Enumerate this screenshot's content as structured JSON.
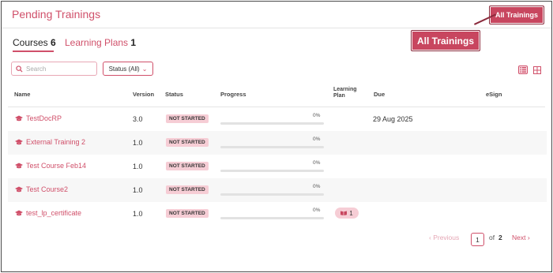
{
  "header": {
    "title": "Pending Trainings",
    "all_trainings_button": "All Trainings",
    "callout_label": "All Trainings"
  },
  "tabs": [
    {
      "label": "Courses",
      "count": "6",
      "active": true
    },
    {
      "label": "Learning Plans",
      "count": "1",
      "active": false
    }
  ],
  "filters": {
    "search_placeholder": "Search",
    "status_label": "Status (All)"
  },
  "columns": {
    "name": "Name",
    "version": "Version",
    "status": "Status",
    "progress": "Progress",
    "learning_plan_line1": "Learning",
    "learning_plan_line2": "Plan",
    "due": "Due",
    "esign": "eSign"
  },
  "rows": [
    {
      "name": "TestDocRP",
      "version": "3.0",
      "status": "NOT STARTED",
      "progress": 0,
      "progress_label": "0%",
      "due": "29 Aug 2025",
      "learning_plan": ""
    },
    {
      "name": "External Training 2",
      "version": "1.0",
      "status": "NOT STARTED",
      "progress": 0,
      "progress_label": "0%",
      "due": "",
      "learning_plan": ""
    },
    {
      "name": "Test Course Feb14",
      "version": "1.0",
      "status": "NOT STARTED",
      "progress": 0,
      "progress_label": "0%",
      "due": "",
      "learning_plan": ""
    },
    {
      "name": "Test Course2",
      "version": "1.0",
      "status": "NOT STARTED",
      "progress": 0,
      "progress_label": "0%",
      "due": "",
      "learning_plan": ""
    },
    {
      "name": "test_lp_certificate",
      "version": "1.0",
      "status": "NOT STARTED",
      "progress": 0,
      "progress_label": "0%",
      "due": "",
      "learning_plan": "1"
    }
  ],
  "pagination": {
    "previous": "‹ Previous",
    "current": "1",
    "of": "of",
    "total": "2",
    "next": "Next ›"
  },
  "colors": {
    "accent": "#d0506a",
    "badge_bg": "#f6cdd5",
    "callout_bg": "#c8465f"
  },
  "icons": {
    "course": "course-icon",
    "search": "search-icon",
    "list_view": "list-view-icon",
    "grid_view": "grid-view-icon",
    "learning_plan": "learning-plan-icon"
  }
}
